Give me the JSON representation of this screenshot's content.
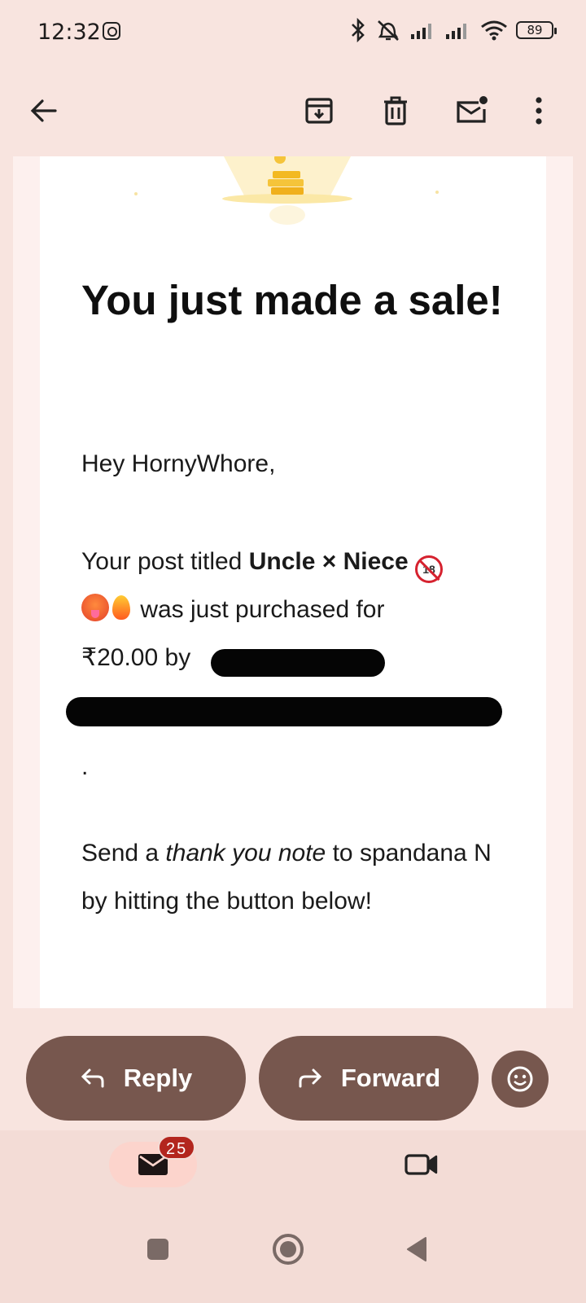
{
  "status_bar": {
    "time": "12:32",
    "battery": "89",
    "icons": [
      "instagram-icon",
      "bluetooth-icon",
      "mute-icon",
      "signal-icon",
      "signal-icon",
      "wifi-icon",
      "battery-icon"
    ]
  },
  "toolbar": {
    "icons": [
      "back-arrow-icon",
      "archive-icon",
      "delete-icon",
      "mark-unread-icon",
      "more-options-icon"
    ]
  },
  "email": {
    "headline": "You just made a sale!",
    "greeting": "Hey HornyWhore,",
    "para1": {
      "prefix": "Your post titled ",
      "post_title": "Uncle × Niece",
      "emojis": [
        "no-under-18-emoji",
        "hot-face-emoji",
        "fire-emoji"
      ],
      "middle": " was just purchased for ",
      "price": "₹20.00",
      "by": " by "
    },
    "trailing_dot": ".",
    "para2": {
      "prefix": "Send a ",
      "emphasis": "thank you note",
      "suffix": " to spandana N by hitting the button below!"
    }
  },
  "actions": {
    "reply_label": "Reply",
    "forward_label": "Forward",
    "react_icon": "smiley-icon"
  },
  "bottom_nav": {
    "mail_badge": "25",
    "icons": [
      "mail-icon",
      "meet-video-icon"
    ]
  },
  "colors": {
    "surface": "#f8e4df",
    "action_button": "#77574e",
    "badge": "#b3261e",
    "selected_tab": "#fcd4cc"
  }
}
